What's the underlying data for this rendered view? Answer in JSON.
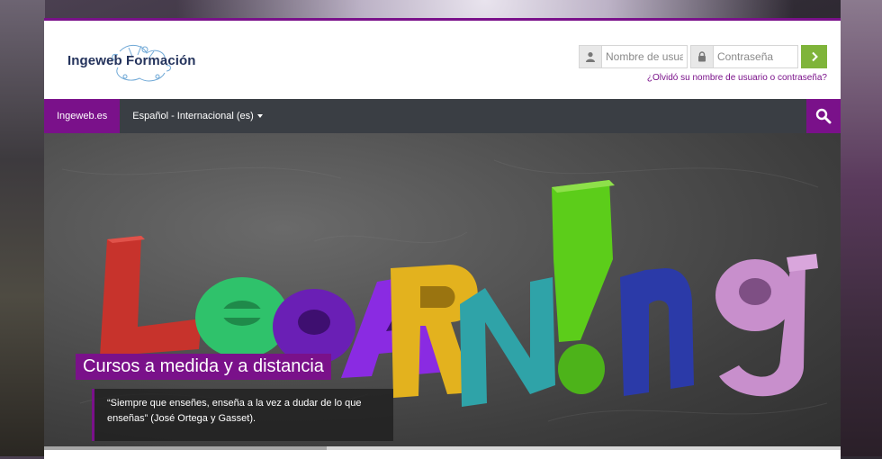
{
  "brand": {
    "name": "Ingeweb Formación"
  },
  "login": {
    "username_placeholder": "Nombre de usuario",
    "password_placeholder": "Contraseña",
    "forgot_link": "¿Olvidó su nombre de usuario o contraseña?"
  },
  "nav": {
    "home_label": "Ingeweb.es",
    "language_label": "Español - Internacional (es)"
  },
  "hero": {
    "title": "Cursos a medida y a distancia",
    "quote": "“Siempre que enseñes, enseña a la vez a dudar de lo que enseñas” (José Ortega y Gasset)."
  },
  "colors": {
    "accent": "#7a118a",
    "navbar": "#3a3e44",
    "submit": "#7fb43a"
  },
  "icons": {
    "user": "user-icon",
    "lock": "lock-icon",
    "submit": "chevron-right-icon",
    "search": "search-icon",
    "caret": "caret-down-icon"
  }
}
